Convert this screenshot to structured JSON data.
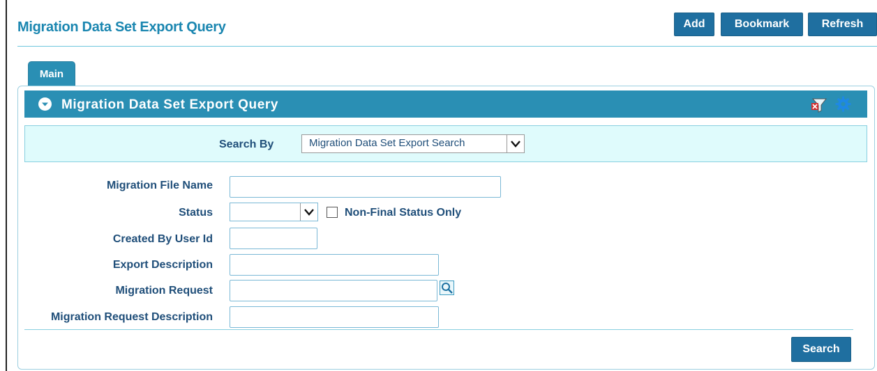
{
  "page": {
    "title": "Migration Data Set Export Query"
  },
  "toolbar": {
    "add_label": "Add",
    "bookmark_label": "Bookmark",
    "refresh_label": "Refresh"
  },
  "tabs": [
    {
      "label": "Main",
      "active": true
    }
  ],
  "panel": {
    "title": "Migration Data Set Export Query",
    "icons": [
      "collapse-icon",
      "clear-filter-icon",
      "gear-icon"
    ]
  },
  "search_by": {
    "label": "Search By",
    "selected": "Migration Data Set Export Search"
  },
  "fields": {
    "migration_file_name": {
      "label": "Migration File Name",
      "value": ""
    },
    "status": {
      "label": "Status",
      "value": ""
    },
    "non_final_status_only": {
      "label": "Non-Final Status Only",
      "checked": false
    },
    "created_by_user_id": {
      "label": "Created By User Id",
      "value": ""
    },
    "export_description": {
      "label": "Export Description",
      "value": ""
    },
    "migration_request": {
      "label": "Migration Request",
      "value": ""
    },
    "migration_request_description": {
      "label": "Migration Request Description",
      "value": ""
    }
  },
  "actions": {
    "search_label": "Search"
  },
  "colors": {
    "accent": "#1a86b0",
    "header_bar": "#2a8fb4",
    "button": "#1f6fa0",
    "label_text": "#1f4e79",
    "search_box_bg": "#dffbfc"
  }
}
